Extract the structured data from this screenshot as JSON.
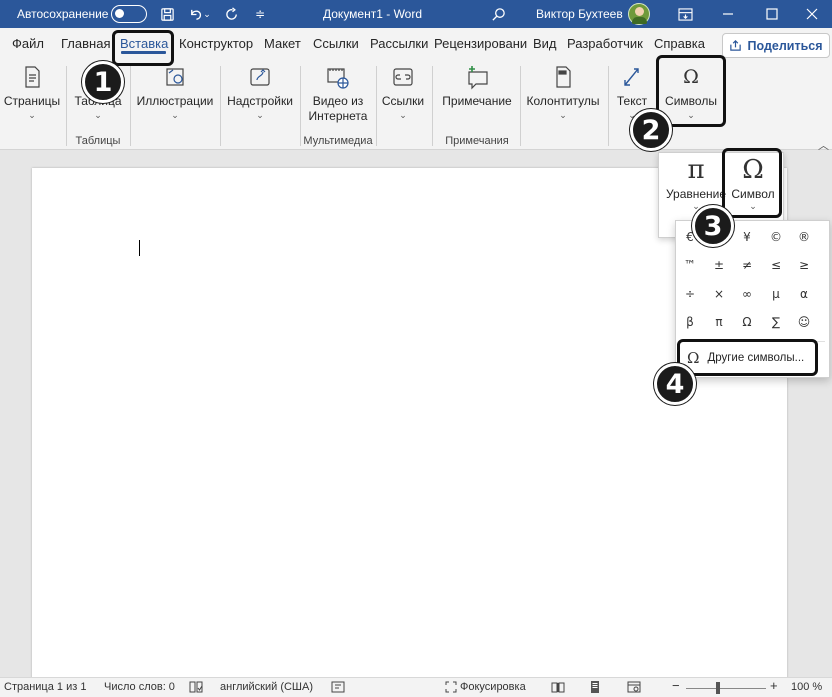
{
  "titlebar": {
    "autosave_label": "Автосохранение",
    "doc_title": "Документ1 - Word",
    "user_name": "Виктор Бухтеев"
  },
  "tabs": [
    {
      "label": "Файл"
    },
    {
      "label": "Главная"
    },
    {
      "label": "Вставка"
    },
    {
      "label": "Конструктор"
    },
    {
      "label": "Макет"
    },
    {
      "label": "Ссылки"
    },
    {
      "label": "Рассылки"
    },
    {
      "label": "Рецензировани"
    },
    {
      "label": "Вид"
    },
    {
      "label": "Разработчик"
    },
    {
      "label": "Справка"
    }
  ],
  "share_label": "Поделиться",
  "ribbon": {
    "pages": "Страницы",
    "table": "Таблица",
    "tables_group": "Таблицы",
    "illustrations": "Иллюстрации",
    "addins": "Надстройки",
    "video_line1": "Видео из",
    "video_line2": "Интернета",
    "media_group": "Мультимедиа",
    "links": "Ссылки",
    "comment": "Примечание",
    "comments_group": "Примечания",
    "header_footer": "Колонтитулы",
    "text": "Текст",
    "symbols": "Символы"
  },
  "symbols_popup": {
    "equation": "Уравнение",
    "symbol": "Символ"
  },
  "gallery": {
    "symbols": [
      "€",
      "£",
      "¥",
      "©",
      "®",
      "™",
      "±",
      "≠",
      "≤",
      "≥",
      "÷",
      "×",
      "∞",
      "µ",
      "α",
      "β",
      "π",
      "Ω",
      "∑",
      "☺"
    ],
    "more_symbols": "Другие символы..."
  },
  "badges": [
    "1",
    "2",
    "3",
    "4"
  ],
  "statusbar": {
    "page": "Страница 1 из 1",
    "words": "Число слов: 0",
    "language": "английский (США)",
    "focus": "Фокусировка",
    "zoom": "100 %"
  },
  "colors": {
    "titlebar": "#2b579a",
    "accent": "#2b579a"
  }
}
